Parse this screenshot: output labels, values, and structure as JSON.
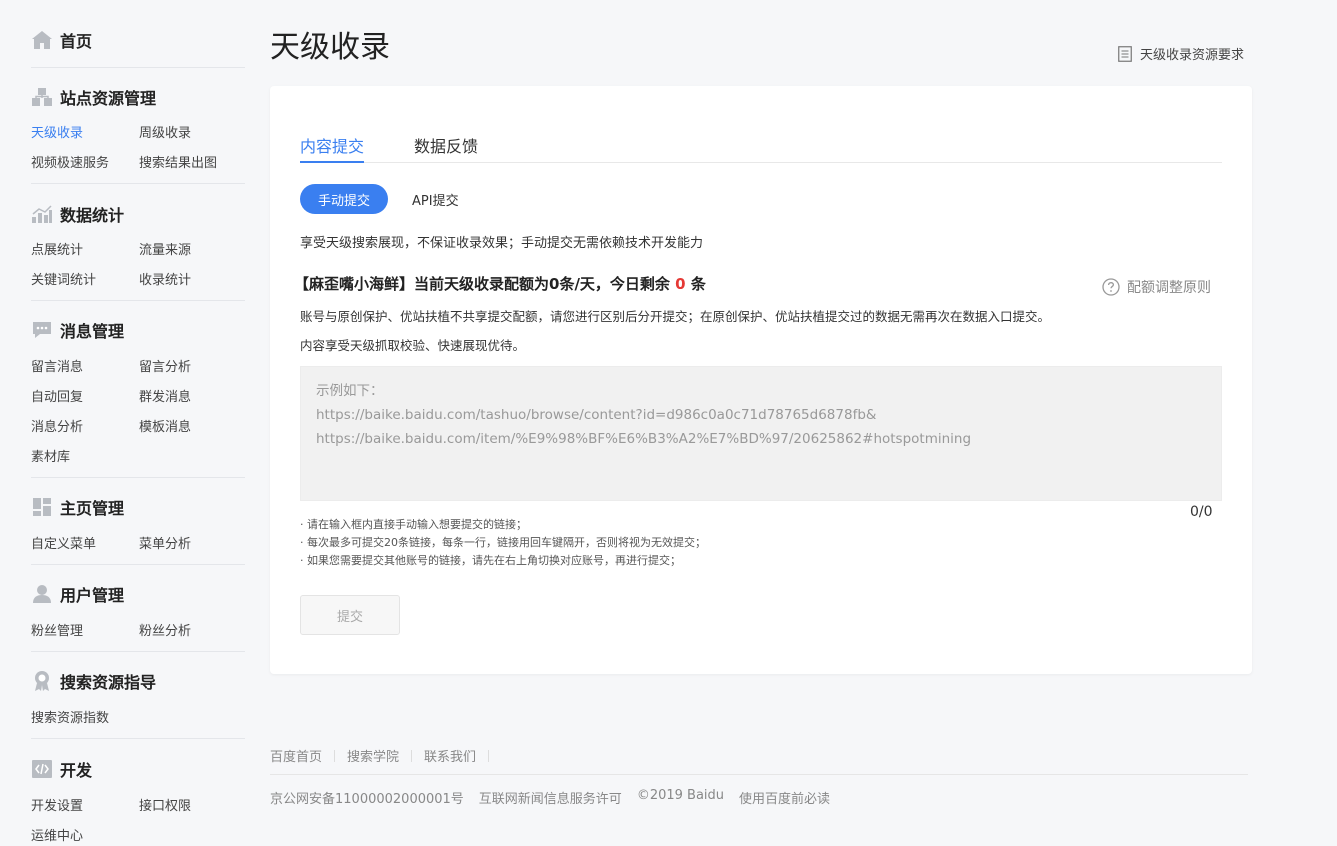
{
  "sidebar": {
    "home": {
      "label": "首页",
      "icon": "home-icon"
    },
    "sections": [
      {
        "title": "站点资源管理",
        "icon": "site-resource-icon",
        "links": [
          "天级收录",
          "周级收录",
          "视频极速服务",
          "搜索结果出图"
        ]
      },
      {
        "title": "数据统计",
        "icon": "chart-icon",
        "links": [
          "点展统计",
          "流量来源",
          "关键词统计",
          "收录统计"
        ]
      },
      {
        "title": "消息管理",
        "icon": "message-icon",
        "links": [
          "留言消息",
          "留言分析",
          "自动回复",
          "群发消息",
          "消息分析",
          "模板消息",
          "素材库"
        ]
      },
      {
        "title": "主页管理",
        "icon": "layout-icon",
        "links": [
          "自定义菜单",
          "菜单分析"
        ]
      },
      {
        "title": "用户管理",
        "icon": "user-icon",
        "links": [
          "粉丝管理",
          "粉丝分析"
        ]
      },
      {
        "title": "搜索资源指导",
        "icon": "badge-icon",
        "links": [
          "搜索资源指数"
        ]
      },
      {
        "title": "开发",
        "icon": "code-icon",
        "links": [
          "开发设置",
          "接口权限",
          "运维中心"
        ]
      }
    ],
    "active_link": "天级收录"
  },
  "header": {
    "title": "天级收录",
    "requirements_link": "天级收录资源要求"
  },
  "card": {
    "tabs": [
      "内容提交",
      "数据反馈"
    ],
    "active_tab": "内容提交",
    "subtabs": [
      "手动提交",
      "API提交"
    ],
    "active_subtab": "手动提交",
    "description": "享受天级搜索展现，不保证收录效果；手动提交无需依赖技术开发能力",
    "quota_prefix": "【麻歪嘴小海鲜】当前天级收录配额为0条/天，今日剩余",
    "quota_remaining": "0",
    "quota_suffix": "条",
    "rule_link": "配额调整原则",
    "note_line1": "账号与原创保护、优站扶植不共享提交配额，请您进行区别后分开提交；在原创保护、优站扶植提交过的数据无需再次在数据入口提交。",
    "note_line2": "内容享受天级抓取校验、快速展现优待。",
    "textarea_placeholder": {
      "line1": "示例如下：",
      "line2": "https://baike.baidu.com/tashuo/browse/content?id=d986c0a0c71d78765d6878fb&",
      "line3": "https://baike.baidu.com/item/%E9%98%BF%E6%B3%A2%E7%BD%97/20625862#hotspotmining"
    },
    "counter": "0/0",
    "tips": [
      "· 请在输入框内直接手动输入想要提交的链接；",
      "· 每次最多可提交20条链接，每条一行，链接用回车键隔开，否则将视为无效提交；",
      "· 如果您需要提交其他账号的链接，请先在右上角切换对应账号，再进行提交；"
    ],
    "submit_label": "提交"
  },
  "footer": {
    "links": [
      "百度首页",
      "搜索学院",
      "联系我们"
    ],
    "info": [
      "京公网安备11000002000001号",
      "互联网新闻信息服务许可",
      "©2019 Baidu",
      "使用百度前必读"
    ]
  },
  "colors": {
    "accent": "#3a7ff0",
    "alert": "#e53935"
  }
}
